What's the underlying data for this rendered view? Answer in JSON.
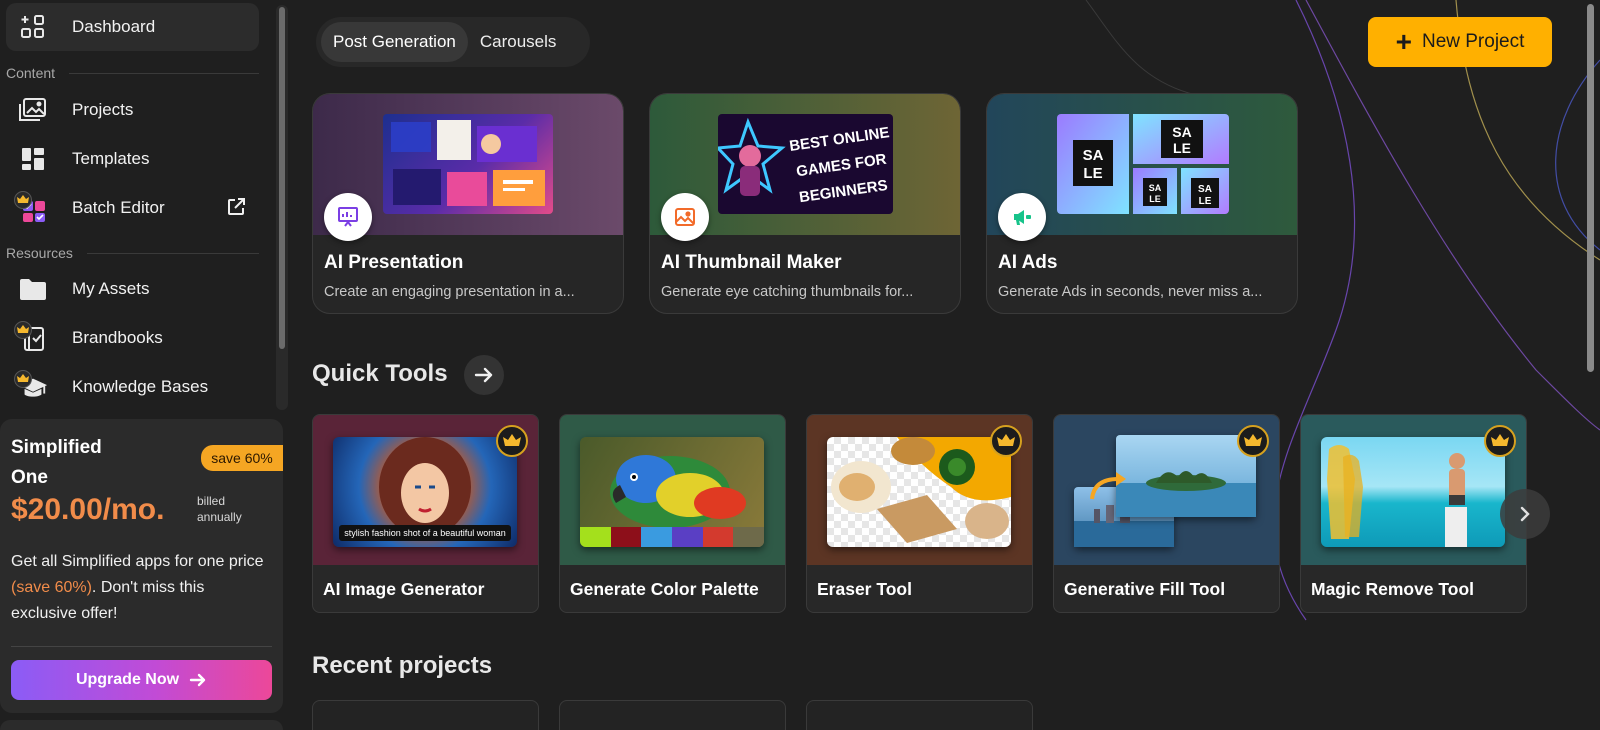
{
  "sidebar": {
    "items": [
      {
        "label": "Dashboard",
        "icon": "dashboard-grid-icon"
      },
      {
        "label": "Projects",
        "icon": "projects-gallery-icon"
      },
      {
        "label": "Templates",
        "icon": "templates-layout-icon"
      },
      {
        "label": "Batch Editor",
        "icon": "batch-editor-icon"
      },
      {
        "label": "My Assets",
        "icon": "folder-icon"
      },
      {
        "label": "Brandbooks",
        "icon": "brandbook-icon"
      },
      {
        "label": "Knowledge Bases",
        "icon": "graduation-cap-icon"
      }
    ],
    "sections": {
      "content": "Content",
      "resources": "Resources"
    }
  },
  "promo": {
    "title": "Simplified One",
    "save_badge": "save 60%",
    "price": "$20.00/mo.",
    "billed": "billed annually",
    "desc_before": "Get all Simplified apps for one price ",
    "desc_highlight": "(save 60%)",
    "desc_after": ". Don't miss this exclusive offer!",
    "button": "Upgrade Now"
  },
  "main": {
    "tabs": [
      {
        "label": "Post Generation",
        "active": true
      },
      {
        "label": "Carousels",
        "active": false
      }
    ],
    "new_project": "New Project",
    "features": [
      {
        "title": "AI Presentation",
        "desc": "Create an engaging presentation in a...",
        "icon": "presentation-icon"
      },
      {
        "title": "AI Thumbnail Maker",
        "desc": "Generate eye catching thumbnails for...",
        "icon": "image-icon",
        "thumb_text": "BEST ONLINE GAMES FOR BEGINNERS"
      },
      {
        "title": "AI Ads",
        "desc": "Generate Ads in seconds, never miss a...",
        "icon": "ads-icon",
        "thumb_text": "SA LE"
      }
    ],
    "quick_tools_title": "Quick Tools",
    "tools": [
      {
        "name": "AI Image Generator",
        "caption": "stylish fashion shot of a beautiful woman",
        "premium": true
      },
      {
        "name": "Generate Color Palette",
        "premium": false,
        "palette": [
          "#a4e01c",
          "#8d0f1a",
          "#3a9be0",
          "#5a3fc4",
          "#d33a2e",
          "#6e6a4a"
        ]
      },
      {
        "name": "Eraser Tool",
        "premium": true
      },
      {
        "name": "Generative Fill Tool",
        "premium": true
      },
      {
        "name": "Magic Remove Tool",
        "premium": true
      }
    ],
    "recent_title": "Recent projects"
  },
  "colors": {
    "accent": "#ffb000",
    "price": "#f18c4a",
    "upgrade_start": "#8b5cf6",
    "upgrade_end": "#ec4899",
    "background": "#1f1f1f"
  }
}
